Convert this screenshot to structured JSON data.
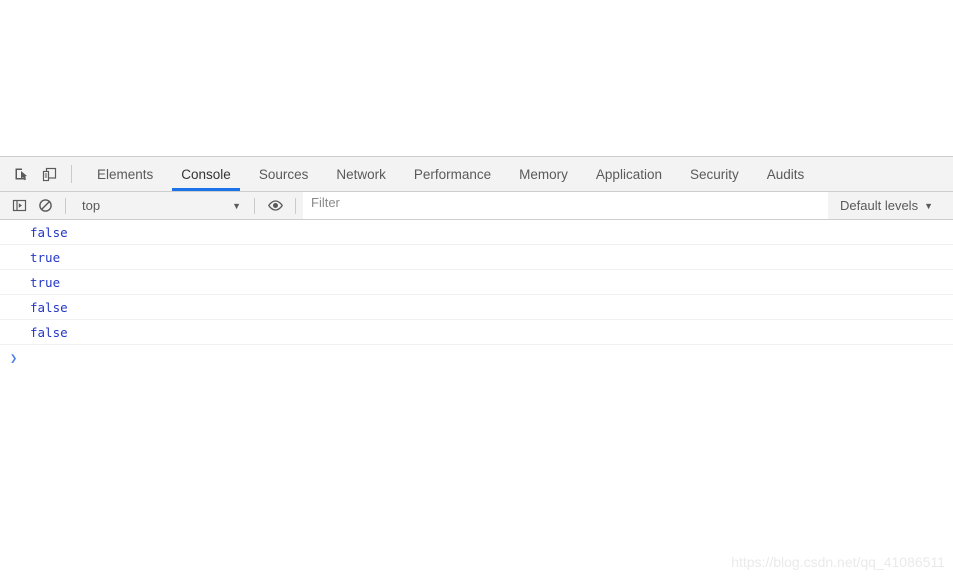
{
  "window": {
    "page_area_background": "#ffffff",
    "devtools_background": "#ffffff",
    "accent_color": "#1a73e8"
  },
  "tabstrip": {
    "inspect_icon_title": "Select an element in the page to inspect it",
    "device_icon_title": "Toggle device toolbar",
    "tabs": [
      {
        "label": "Elements",
        "active": false
      },
      {
        "label": "Console",
        "active": true
      },
      {
        "label": "Sources",
        "active": false
      },
      {
        "label": "Network",
        "active": false
      },
      {
        "label": "Performance",
        "active": false
      },
      {
        "label": "Memory",
        "active": false
      },
      {
        "label": "Application",
        "active": false
      },
      {
        "label": "Security",
        "active": false
      },
      {
        "label": "Audits",
        "active": false
      }
    ]
  },
  "filterbar": {
    "sidebar_toggle_title": "Show console sidebar",
    "clear_console_title": "Clear console",
    "context": {
      "selected": "top",
      "caret": "▼"
    },
    "eye_title": "Create live expression",
    "filter": {
      "value": "",
      "placeholder": "Filter"
    },
    "levels": {
      "label": "Default levels",
      "caret": "▼"
    }
  },
  "console": {
    "rows": [
      {
        "text": "false",
        "color": "#2337c7"
      },
      {
        "text": "true",
        "color": "#2337c7"
      },
      {
        "text": "true",
        "color": "#2337c7"
      },
      {
        "text": "false",
        "color": "#2337c7"
      },
      {
        "text": "false",
        "color": "#2337c7"
      }
    ],
    "prompt": {
      "chevron": "❯",
      "value": ""
    }
  },
  "watermark": {
    "text": "https://blog.csdn.net/qq_41086511"
  }
}
